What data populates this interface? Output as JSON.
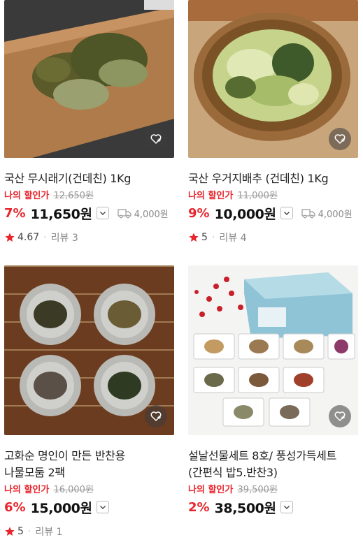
{
  "products": [
    {
      "title": "국산 무시래기(건데친) 1Kg",
      "my_discount_label": "나의 할인가",
      "original_price": "12,650원",
      "discount_rate": "7%",
      "price": "11,650원",
      "shipping": "4,000원",
      "rating": "4.67",
      "review_label": "리뷰 3"
    },
    {
      "title": "국산 우거지배추 (건데친) 1Kg",
      "my_discount_label": "나의 할인가",
      "original_price": "11,000원",
      "discount_rate": "9%",
      "price": "10,000원",
      "shipping": "4,000원",
      "rating": "5",
      "review_label": "리뷰 4"
    },
    {
      "title_line1": "고화순 명인이 만든 반찬용",
      "title_line2": "나물모둠 2팩",
      "my_discount_label": "나의 할인가",
      "original_price": "16,000원",
      "discount_rate": "6%",
      "price": "15,000원",
      "rating": "5",
      "review_label": "리뷰 1"
    },
    {
      "title_line1": "설날선물세트 8호/ 풍성가득세트",
      "title_line2": "(간편식 밥5.반찬3)",
      "my_discount_label": "나의 할인가",
      "original_price": "39,500원",
      "discount_rate": "2%",
      "price": "38,500원"
    }
  ],
  "icons": {
    "wishlist": "heart-plus-icon",
    "price_dropdown": "chevron-down-icon",
    "shipping": "delivery-truck-icon",
    "rating": "star-icon"
  },
  "colors": {
    "accent_red": "#e8262d",
    "star": "#e8262d",
    "muted": "#9a9a9a"
  }
}
